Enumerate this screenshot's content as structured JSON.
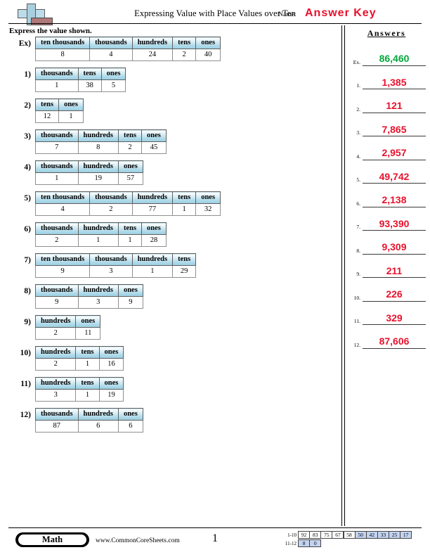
{
  "header": {
    "title": "Expressing Value with Place Values over Ten",
    "name_label": "Name:",
    "name_value": "Answer Key",
    "logo_icon": "plus-block-logo"
  },
  "instruction": "Express the value shown.",
  "answers_panel": {
    "heading": "Answers",
    "rows": [
      {
        "index": "Ex.",
        "value": "86,460",
        "color": "#00a83a"
      },
      {
        "index": "1.",
        "value": "1,385",
        "color": "#e8112d"
      },
      {
        "index": "2.",
        "value": "121",
        "color": "#e8112d"
      },
      {
        "index": "3.",
        "value": "7,865",
        "color": "#e8112d"
      },
      {
        "index": "4.",
        "value": "2,957",
        "color": "#e8112d"
      },
      {
        "index": "5.",
        "value": "49,742",
        "color": "#e8112d"
      },
      {
        "index": "6.",
        "value": "2,138",
        "color": "#e8112d"
      },
      {
        "index": "7.",
        "value": "93,390",
        "color": "#e8112d"
      },
      {
        "index": "8.",
        "value": "9,309",
        "color": "#e8112d"
      },
      {
        "index": "9.",
        "value": "211",
        "color": "#e8112d"
      },
      {
        "index": "10.",
        "value": "226",
        "color": "#e8112d"
      },
      {
        "index": "11.",
        "value": "329",
        "color": "#e8112d"
      },
      {
        "index": "12.",
        "value": "87,606",
        "color": "#e8112d"
      }
    ]
  },
  "problems": [
    {
      "number": "Ex)",
      "headers": [
        "ten thousands",
        "thousands",
        "hundreds",
        "tens",
        "ones"
      ],
      "values": [
        "8",
        "4",
        "24",
        "2",
        "40"
      ]
    },
    {
      "number": "1)",
      "headers": [
        "thousands",
        "tens",
        "ones"
      ],
      "values": [
        "1",
        "38",
        "5"
      ]
    },
    {
      "number": "2)",
      "headers": [
        "tens",
        "ones"
      ],
      "values": [
        "12",
        "1"
      ]
    },
    {
      "number": "3)",
      "headers": [
        "thousands",
        "hundreds",
        "tens",
        "ones"
      ],
      "values": [
        "7",
        "8",
        "2",
        "45"
      ]
    },
    {
      "number": "4)",
      "headers": [
        "thousands",
        "hundreds",
        "ones"
      ],
      "values": [
        "1",
        "19",
        "57"
      ]
    },
    {
      "number": "5)",
      "headers": [
        "ten thousands",
        "thousands",
        "hundreds",
        "tens",
        "ones"
      ],
      "values": [
        "4",
        "2",
        "77",
        "1",
        "32"
      ]
    },
    {
      "number": "6)",
      "headers": [
        "thousands",
        "hundreds",
        "tens",
        "ones"
      ],
      "values": [
        "2",
        "1",
        "1",
        "28"
      ]
    },
    {
      "number": "7)",
      "headers": [
        "ten thousands",
        "thousands",
        "hundreds",
        "tens"
      ],
      "values": [
        "9",
        "3",
        "1",
        "29"
      ]
    },
    {
      "number": "8)",
      "headers": [
        "thousands",
        "hundreds",
        "ones"
      ],
      "values": [
        "9",
        "3",
        "9"
      ]
    },
    {
      "number": "9)",
      "headers": [
        "hundreds",
        "ones"
      ],
      "values": [
        "2",
        "11"
      ]
    },
    {
      "number": "10)",
      "headers": [
        "hundreds",
        "tens",
        "ones"
      ],
      "values": [
        "2",
        "1",
        "16"
      ]
    },
    {
      "number": "11)",
      "headers": [
        "hundreds",
        "tens",
        "ones"
      ],
      "values": [
        "3",
        "1",
        "19"
      ]
    },
    {
      "number": "12)",
      "headers": [
        "thousands",
        "hundreds",
        "ones"
      ],
      "values": [
        "87",
        "6",
        "6"
      ]
    }
  ],
  "footer": {
    "subject": "Math",
    "url": "www.CommonCoreSheets.com",
    "page_number": "1",
    "score_table": [
      {
        "range": "1-10",
        "cells": [
          {
            "value": "92",
            "shaded": false
          },
          {
            "value": "83",
            "shaded": false
          },
          {
            "value": "75",
            "shaded": false
          },
          {
            "value": "67",
            "shaded": false
          },
          {
            "value": "58",
            "shaded": false
          },
          {
            "value": "50",
            "shaded": true
          },
          {
            "value": "42",
            "shaded": true
          },
          {
            "value": "33",
            "shaded": true
          },
          {
            "value": "25",
            "shaded": true
          },
          {
            "value": "17",
            "shaded": true
          }
        ]
      },
      {
        "range": "11-12",
        "cells": [
          {
            "value": "8",
            "shaded": true
          },
          {
            "value": "0",
            "shaded": true
          }
        ]
      }
    ]
  },
  "colors": {
    "answer_red": "#e8112d",
    "example_green": "#00a83a",
    "header_cell_blue": "#a9d7e8",
    "score_shade_blue": "#c3d3f0"
  }
}
